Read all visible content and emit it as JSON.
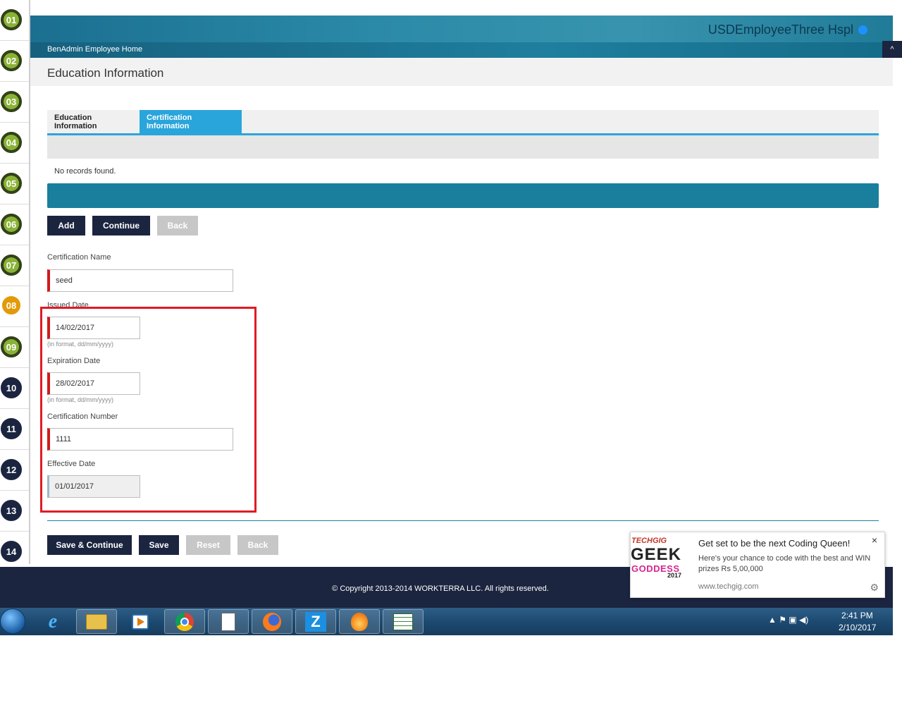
{
  "steps": [
    "01",
    "02",
    "03",
    "04",
    "05",
    "06",
    "07",
    "08",
    "09",
    "10",
    "11",
    "12",
    "13",
    "14"
  ],
  "header": {
    "user_name": "USDEmployeeThree Hspl",
    "nav_link": "BenAdmin Employee Home",
    "collapse_icon": "^",
    "page_title": "Education Information"
  },
  "tabs": [
    {
      "label": "Education Information",
      "active": false
    },
    {
      "label": "Certification Information",
      "active": true
    }
  ],
  "grid": {
    "empty_message": "No records found."
  },
  "grid_buttons": {
    "add": "Add",
    "continue": "Continue",
    "back": "Back"
  },
  "form": {
    "certification_name": {
      "label": "Certification Name",
      "value": "seed"
    },
    "issued_date": {
      "label": "Issued Date",
      "value": "14/02/2017",
      "hint": "(in format, dd/mm/yyyy)"
    },
    "expiration_date": {
      "label": "Expiration Date",
      "value": "28/02/2017",
      "hint": "(in format, dd/mm/yyyy)"
    },
    "certification_number": {
      "label": "Certification Number",
      "value": "1111"
    },
    "effective_date": {
      "label": "Effective Date",
      "value": "01/01/2017"
    }
  },
  "form_buttons": {
    "save_continue": "Save & Continue",
    "save": "Save",
    "reset": "Reset",
    "back": "Back"
  },
  "footer": {
    "copyright": "© Copyright 2013-2014 WORKTERRA LLC. All rights reserved."
  },
  "notification": {
    "logo_top": "TECHGIG",
    "logo_main": "GEEK",
    "logo_sub": "GODDESS",
    "logo_year": "2017",
    "title": "Get set to be the next Coding Queen!",
    "body": "Here's your chance to code with the best and WIN prizes Rs 5,00,000",
    "url": "www.techgig.com",
    "close": "×",
    "gear": "⚙"
  },
  "taskbar": {
    "apps": [
      "ie-icon",
      "file-explorer-icon",
      "media-player-icon",
      "chrome-icon",
      "notepad-icon",
      "firefox-icon",
      "z-app-icon",
      "orange-app-icon",
      "spreadsheet-icon"
    ],
    "z_label": "Z",
    "tray": "▲ ⚑ ▣ ◀)",
    "time": "2:41 PM",
    "date": "2/10/2017"
  },
  "colors": {
    "header_teal": "#1a7f9c",
    "tab_active": "#2aa5dc",
    "button_dark": "#1b2540",
    "required_red": "#d11b1b",
    "highlight_red": "#e01b24",
    "step_green": "#8ab236",
    "step_orange": "#e39a0a",
    "step_navy": "#1b2540"
  }
}
